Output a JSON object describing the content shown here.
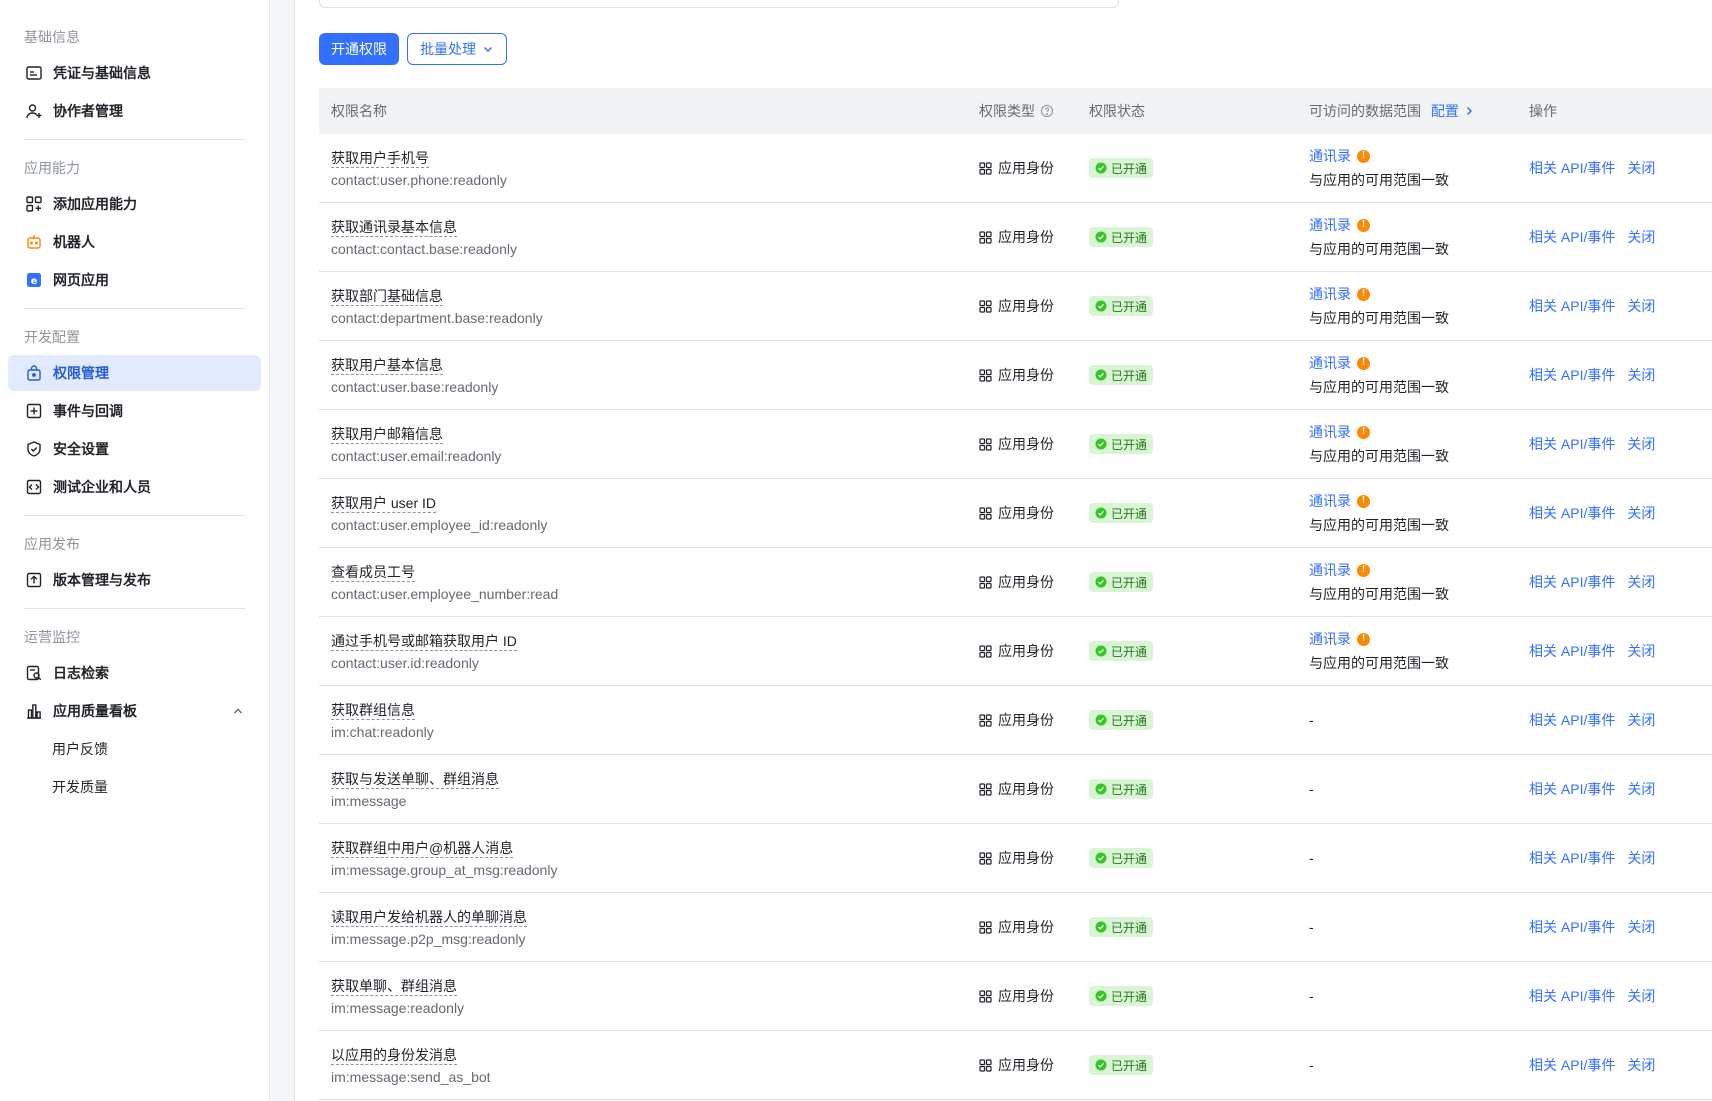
{
  "sidebar": {
    "groups": [
      {
        "title": "基础信息",
        "items": [
          {
            "label": "凭证与基础信息",
            "icon": "credential-icon"
          },
          {
            "label": "协作者管理",
            "icon": "user-add-icon"
          }
        ]
      },
      {
        "title": "应用能力",
        "items": [
          {
            "label": "添加应用能力",
            "icon": "apps-add-icon"
          },
          {
            "label": "机器人",
            "icon": "robot-icon"
          },
          {
            "label": "网页应用",
            "icon": "web-app-icon"
          }
        ]
      },
      {
        "title": "开发配置",
        "items": [
          {
            "label": "权限管理",
            "icon": "lock-icon"
          },
          {
            "label": "事件与回调",
            "icon": "event-icon"
          },
          {
            "label": "安全设置",
            "icon": "shield-icon"
          },
          {
            "label": "测试企业和人员",
            "icon": "code-icon"
          }
        ]
      },
      {
        "title": "应用发布",
        "items": [
          {
            "label": "版本管理与发布",
            "icon": "upload-icon"
          }
        ]
      },
      {
        "title": "运营监控",
        "items": [
          {
            "label": "日志检索",
            "icon": "log-search-icon"
          },
          {
            "label": "应用质量看板",
            "icon": "chart-icon"
          },
          {
            "label": "用户反馈"
          },
          {
            "label": "开发质量"
          }
        ]
      }
    ],
    "active": "权限管理"
  },
  "toolbar": {
    "primary_label": "开通权限",
    "batch_label": "批量处理"
  },
  "table": {
    "headers": {
      "name": "权限名称",
      "type": "权限类型",
      "status": "权限状态",
      "scope": "可访问的数据范围",
      "scope_config": "配置",
      "ops": "操作"
    },
    "rows": [
      {
        "name": "获取用户手机号",
        "code": "contact:user.phone:readonly",
        "type": "应用身份",
        "status": "已开通",
        "scope_link": "通讯录",
        "scope_text": "与应用的可用范围一致",
        "ops": [
          "相关 API/事件",
          "关闭"
        ]
      },
      {
        "name": "获取通讯录基本信息",
        "code": "contact:contact.base:readonly",
        "type": "应用身份",
        "status": "已开通",
        "scope_link": "通讯录",
        "scope_text": "与应用的可用范围一致",
        "ops": [
          "相关 API/事件",
          "关闭"
        ]
      },
      {
        "name": "获取部门基础信息",
        "code": "contact:department.base:readonly",
        "type": "应用身份",
        "status": "已开通",
        "scope_link": "通讯录",
        "scope_text": "与应用的可用范围一致",
        "ops": [
          "相关 API/事件",
          "关闭"
        ]
      },
      {
        "name": "获取用户基本信息",
        "code": "contact:user.base:readonly",
        "type": "应用身份",
        "status": "已开通",
        "scope_link": "通讯录",
        "scope_text": "与应用的可用范围一致",
        "ops": [
          "相关 API/事件",
          "关闭"
        ]
      },
      {
        "name": "获取用户邮箱信息",
        "code": "contact:user.email:readonly",
        "type": "应用身份",
        "status": "已开通",
        "scope_link": "通讯录",
        "scope_text": "与应用的可用范围一致",
        "ops": [
          "相关 API/事件",
          "关闭"
        ]
      },
      {
        "name": "获取用户 user ID",
        "code": "contact:user.employee_id:readonly",
        "type": "应用身份",
        "status": "已开通",
        "scope_link": "通讯录",
        "scope_text": "与应用的可用范围一致",
        "ops": [
          "相关 API/事件",
          "关闭"
        ]
      },
      {
        "name": "查看成员工号",
        "code": "contact:user.employee_number:read",
        "type": "应用身份",
        "status": "已开通",
        "scope_link": "通讯录",
        "scope_text": "与应用的可用范围一致",
        "ops": [
          "相关 API/事件",
          "关闭"
        ]
      },
      {
        "name": "通过手机号或邮箱获取用户 ID",
        "code": "contact:user.id:readonly",
        "type": "应用身份",
        "status": "已开通",
        "scope_link": "通讯录",
        "scope_text": "与应用的可用范围一致",
        "ops": [
          "相关 API/事件",
          "关闭"
        ]
      },
      {
        "name": "获取群组信息",
        "code": "im:chat:readonly",
        "type": "应用身份",
        "status": "已开通",
        "scope_dash": "-",
        "ops": [
          "相关 API/事件",
          "关闭"
        ]
      },
      {
        "name": "获取与发送单聊、群组消息",
        "code": "im:message",
        "type": "应用身份",
        "status": "已开通",
        "scope_dash": "-",
        "ops": [
          "相关 API/事件",
          "关闭"
        ]
      },
      {
        "name": "获取群组中用户@机器人消息",
        "code": "im:message.group_at_msg:readonly",
        "type": "应用身份",
        "status": "已开通",
        "scope_dash": "-",
        "ops": [
          "相关 API/事件",
          "关闭"
        ]
      },
      {
        "name": "读取用户发给机器人的单聊消息",
        "code": "im:message.p2p_msg:readonly",
        "type": "应用身份",
        "status": "已开通",
        "scope_dash": "-",
        "ops": [
          "相关 API/事件",
          "关闭"
        ]
      },
      {
        "name": "获取单聊、群组消息",
        "code": "im:message:readonly",
        "type": "应用身份",
        "status": "已开通",
        "scope_dash": "-",
        "ops": [
          "相关 API/事件",
          "关闭"
        ]
      },
      {
        "name": "以应用的身份发消息",
        "code": "im:message:send_as_bot",
        "type": "应用身份",
        "status": "已开通",
        "scope_dash": "-",
        "ops": [
          "相关 API/事件",
          "关闭"
        ]
      }
    ]
  },
  "colors": {
    "accent": "#3370ff",
    "active_bg": "#e1eaff",
    "status_bg": "#d9f5d6",
    "status_fg": "#237b19",
    "warn": "#ff8800"
  }
}
